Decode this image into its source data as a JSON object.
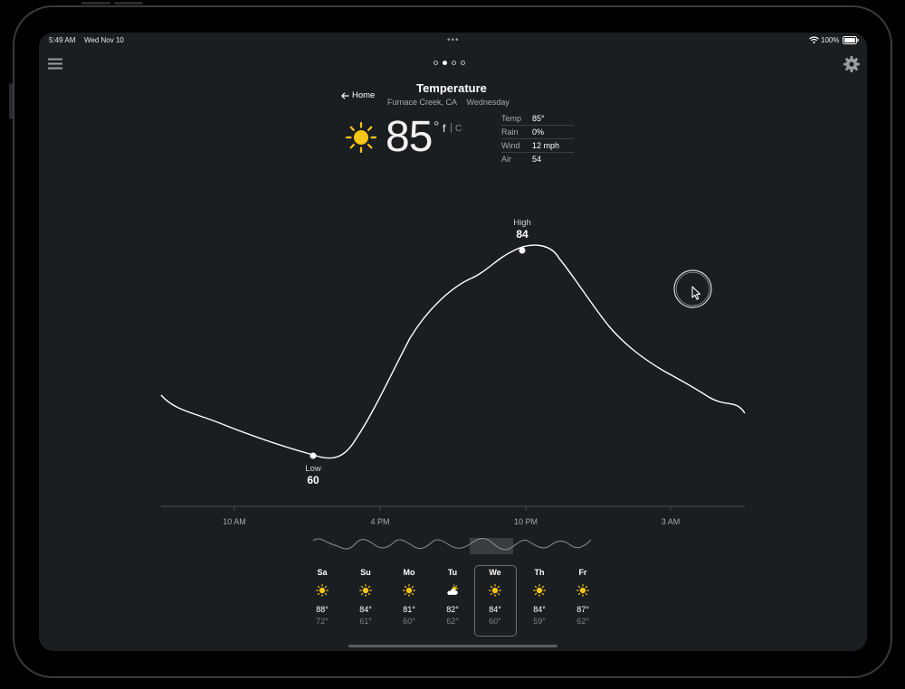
{
  "status": {
    "time": "5:49 AM",
    "date": "Wed Nov 10",
    "battery": "100%"
  },
  "header": {
    "back_label": "Home",
    "title": "Temperature",
    "location": "Furnace Creek, CA",
    "day": "Wednesday"
  },
  "current": {
    "temperature": "85",
    "degree": "°",
    "unit_f": "f",
    "unit_sep": "|",
    "unit_c": "C",
    "icon": "sun-icon"
  },
  "stats": [
    {
      "label": "Temp",
      "value": "85°"
    },
    {
      "label": "Rain",
      "value": "0%"
    },
    {
      "label": "Wind",
      "value": "12 mph"
    },
    {
      "label": "Air",
      "value": "54"
    }
  ],
  "page_indicator": {
    "count": 4,
    "active_index": 1
  },
  "graph": {
    "high_label": "High",
    "high_value": "84",
    "low_label": "Low",
    "low_value": "60",
    "x_ticks": [
      "10 AM",
      "4 PM",
      "10 PM",
      "3 AM"
    ]
  },
  "forecast": [
    {
      "day": "Sa",
      "icon": "sun-icon",
      "high": "88°",
      "low": "72°"
    },
    {
      "day": "Su",
      "icon": "sun-icon",
      "high": "84°",
      "low": "61°"
    },
    {
      "day": "Mo",
      "icon": "sun-icon",
      "high": "81°",
      "low": "60°"
    },
    {
      "day": "Tu",
      "icon": "partly-cloudy-icon",
      "high": "82°",
      "low": "62°"
    },
    {
      "day": "We",
      "icon": "sun-icon",
      "high": "84°",
      "low": "60°",
      "selected": true
    },
    {
      "day": "Th",
      "icon": "sun-icon",
      "high": "84°",
      "low": "59°"
    },
    {
      "day": "Fr",
      "icon": "sun-icon",
      "high": "87°",
      "low": "62°"
    }
  ],
  "colors": {
    "background": "#1b1e21",
    "accent_sun": "#f5c518",
    "text_muted": "#a7a9ab"
  }
}
